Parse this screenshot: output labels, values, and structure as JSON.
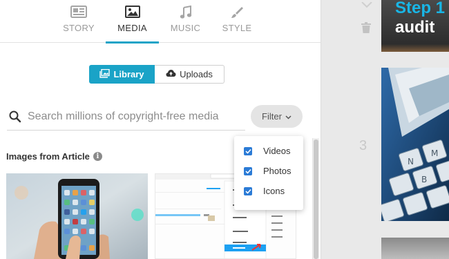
{
  "tabs": [
    {
      "label": "STORY",
      "icon": "newspaper-icon",
      "active": false
    },
    {
      "label": "MEDIA",
      "icon": "image-icon",
      "active": true
    },
    {
      "label": "MUSIC",
      "icon": "music-note-icon",
      "active": false
    },
    {
      "label": "STYLE",
      "icon": "paintbrush-icon",
      "active": false
    }
  ],
  "source_toggle": {
    "library_label": "Library",
    "uploads_label": "Uploads",
    "selected": "Library"
  },
  "search": {
    "placeholder": "Search millions of copyright-free media",
    "value": ""
  },
  "filter": {
    "label": "Filter",
    "options": [
      {
        "label": "Videos",
        "checked": true
      },
      {
        "label": "Photos",
        "checked": true
      },
      {
        "label": "Icons",
        "checked": true
      }
    ]
  },
  "section": {
    "title": "Images from Article"
  },
  "storyboard": {
    "row_number": "3",
    "card1_line1": "Step 1",
    "card1_line2": "audit"
  },
  "colors": {
    "accent": "#1aa3c7",
    "checkbox": "#2b7bd6",
    "caption_blue": "#19b6e6"
  }
}
